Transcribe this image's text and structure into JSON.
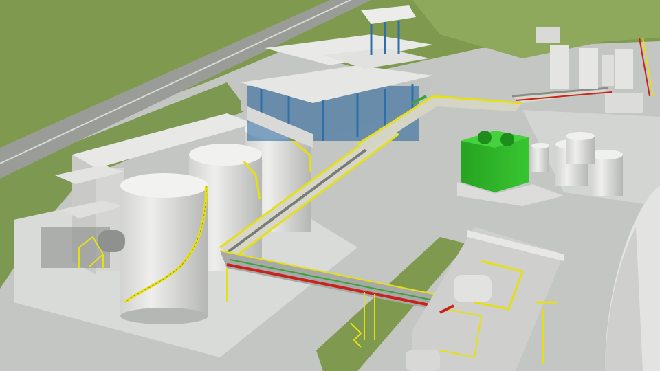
{
  "scene": {
    "subject": "industrial-plant-3d-render",
    "colors": {
      "grass": "#7f9a4f",
      "grass_light": "#8ea85c",
      "road": "#9a9c98",
      "ground": "#c4c6c3",
      "concrete": "#d9dbd8",
      "tank": "#e6e7e5",
      "tank_shade": "#b9bbb8",
      "safety_yellow": "#e5e015",
      "steel_blue": "#2f6fa8",
      "cooling_green": "#2fb52a",
      "pipe_red": "#c8221d",
      "pipe_green": "#3aa33a",
      "shadow": "#8e908d"
    }
  }
}
